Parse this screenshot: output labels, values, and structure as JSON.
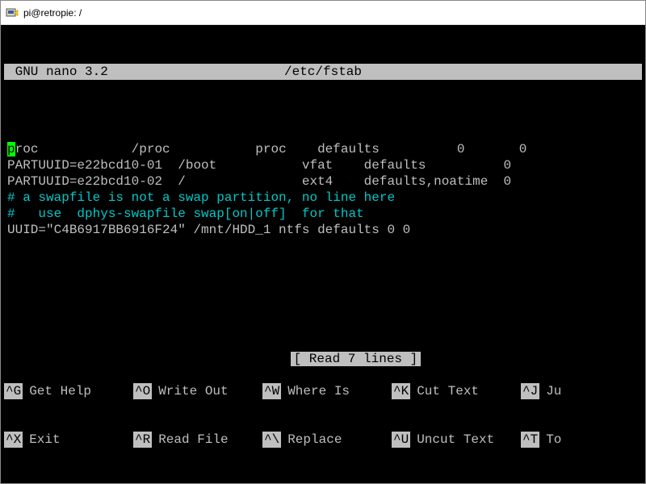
{
  "window": {
    "title": "pi@retropie: /"
  },
  "nano": {
    "header_left": " GNU nano 3.2",
    "header_file": "/etc/fstab",
    "status": "[ Read 7 lines ]",
    "content": {
      "cursor_char": "p",
      "line1_rest": "roc            /proc           proc    defaults          0       0",
      "line2": "PARTUUID=e22bcd10-01  /boot           vfat    defaults          0",
      "line3": "PARTUUID=e22bcd10-02  /               ext4    defaults,noatime  0",
      "comment1": "# a swapfile is not a swap partition, no line here",
      "comment2": "#   use  dphys-swapfile swap[on|off]  for that",
      "blank": "",
      "line_uuid": "UUID=\"C4B6917BB6916F24\" /mnt/HDD_1 ntfs defaults 0 0"
    },
    "shortcuts": {
      "row1": [
        {
          "key": "^G",
          "label": "Get Help"
        },
        {
          "key": "^O",
          "label": "Write Out"
        },
        {
          "key": "^W",
          "label": "Where Is"
        },
        {
          "key": "^K",
          "label": "Cut Text"
        },
        {
          "key": "^J",
          "label": "Ju"
        }
      ],
      "row2": [
        {
          "key": "^X",
          "label": "Exit"
        },
        {
          "key": "^R",
          "label": "Read File"
        },
        {
          "key": "^\\",
          "label": "Replace"
        },
        {
          "key": "^U",
          "label": "Uncut Text"
        },
        {
          "key": "^T",
          "label": "To"
        }
      ]
    }
  }
}
